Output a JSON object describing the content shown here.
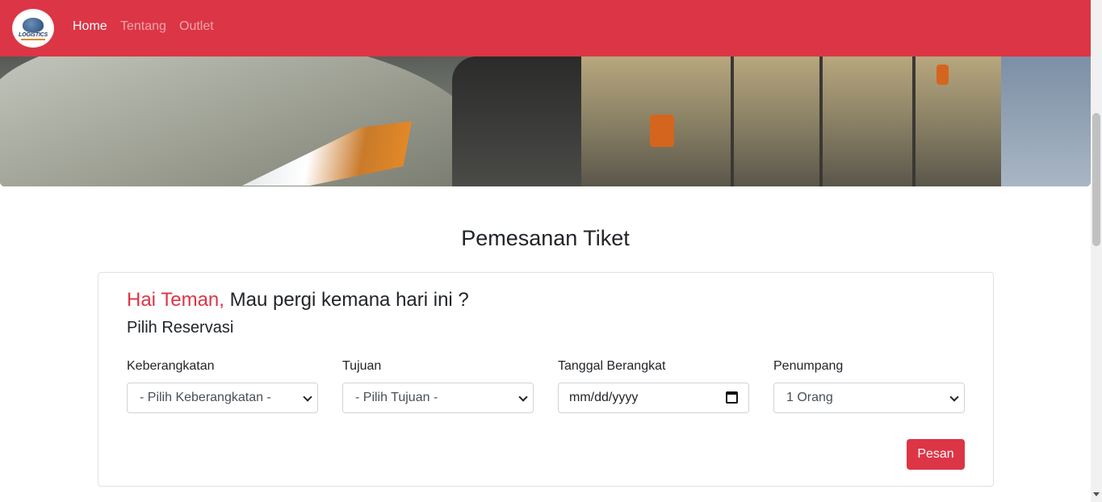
{
  "navbar": {
    "logo_text": "LOGISTICS",
    "links": [
      {
        "label": "Home"
      },
      {
        "label": "Tentang"
      },
      {
        "label": "Outlet"
      }
    ],
    "color": "#dc3545"
  },
  "main": {
    "title": "Pemesanan Tiket",
    "greeting_highlight": "Hai Teman,",
    "greeting_rest": " Mau pergi kemana hari ini ?",
    "subtitle": "Pilih Reservasi"
  },
  "form": {
    "departure": {
      "label": "Keberangkatan",
      "value": "- Pilih Keberangkatan -"
    },
    "destination": {
      "label": "Tujuan",
      "value": "- Pilih Tujuan -"
    },
    "date": {
      "label": "Tanggal Berangkat",
      "value": "mm/dd/yyyy"
    },
    "passengers": {
      "label": "Penumpang",
      "value": "1 Orang"
    },
    "submit_label": "Pesan"
  },
  "icons": {
    "select_caret": "chevron-down-icon",
    "date_picker": "calendar-icon"
  }
}
